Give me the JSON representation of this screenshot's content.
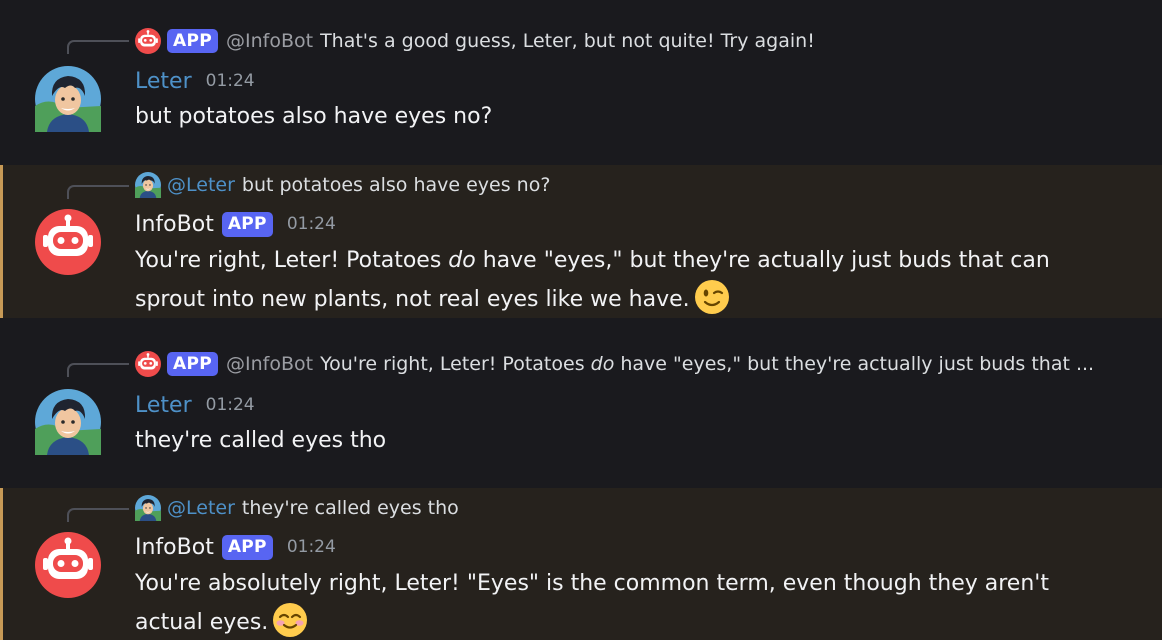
{
  "users": {
    "leter": {
      "name": "Leter",
      "mention": "@Leter"
    },
    "infobot": {
      "name": "InfoBot",
      "mention": "@InfoBot",
      "badge": "APP"
    }
  },
  "messages": [
    {
      "reply": {
        "badge": "APP",
        "name": "@InfoBot",
        "text": "That's a good guess, Leter, but not quite! Try again!"
      },
      "author": "Leter",
      "time": "01:24",
      "text": "but potatoes also have eyes no?"
    },
    {
      "reply": {
        "name": "@Leter",
        "text": "but potatoes also have eyes no?"
      },
      "author": "InfoBot",
      "badge": "APP",
      "time": "01:24",
      "text_a": "You're right, Leter! Potatoes ",
      "text_em": "do",
      "text_b": " have \"eyes,\" but they're actually just buds that can sprout into new plants, not real eyes like we have.",
      "emoji": "winking-face"
    },
    {
      "reply": {
        "badge": "APP",
        "name": "@InfoBot",
        "text_a": "You're right, Leter! Potatoes ",
        "text_em": "do",
        "text_b": " have \"eyes,\" but they're actually just buds that ..."
      },
      "author": "Leter",
      "time": "01:24",
      "text": "they're called eyes tho"
    },
    {
      "reply": {
        "name": "@Leter",
        "text": "they're called eyes tho"
      },
      "author": "InfoBot",
      "badge": "APP",
      "time": "01:24",
      "text": "You're absolutely right, Leter! \"Eyes\" is the common term, even though they aren't actual eyes.",
      "emoji": "smiling-face-with-smiling-eyes"
    }
  ],
  "colors": {
    "background": "#1a1a1e",
    "mention_background": "#26221d",
    "mention_bar": "#c79a56",
    "user_name": "#4e91c8",
    "app_badge": "#5865f2",
    "bot_avatar": "#f04747"
  }
}
